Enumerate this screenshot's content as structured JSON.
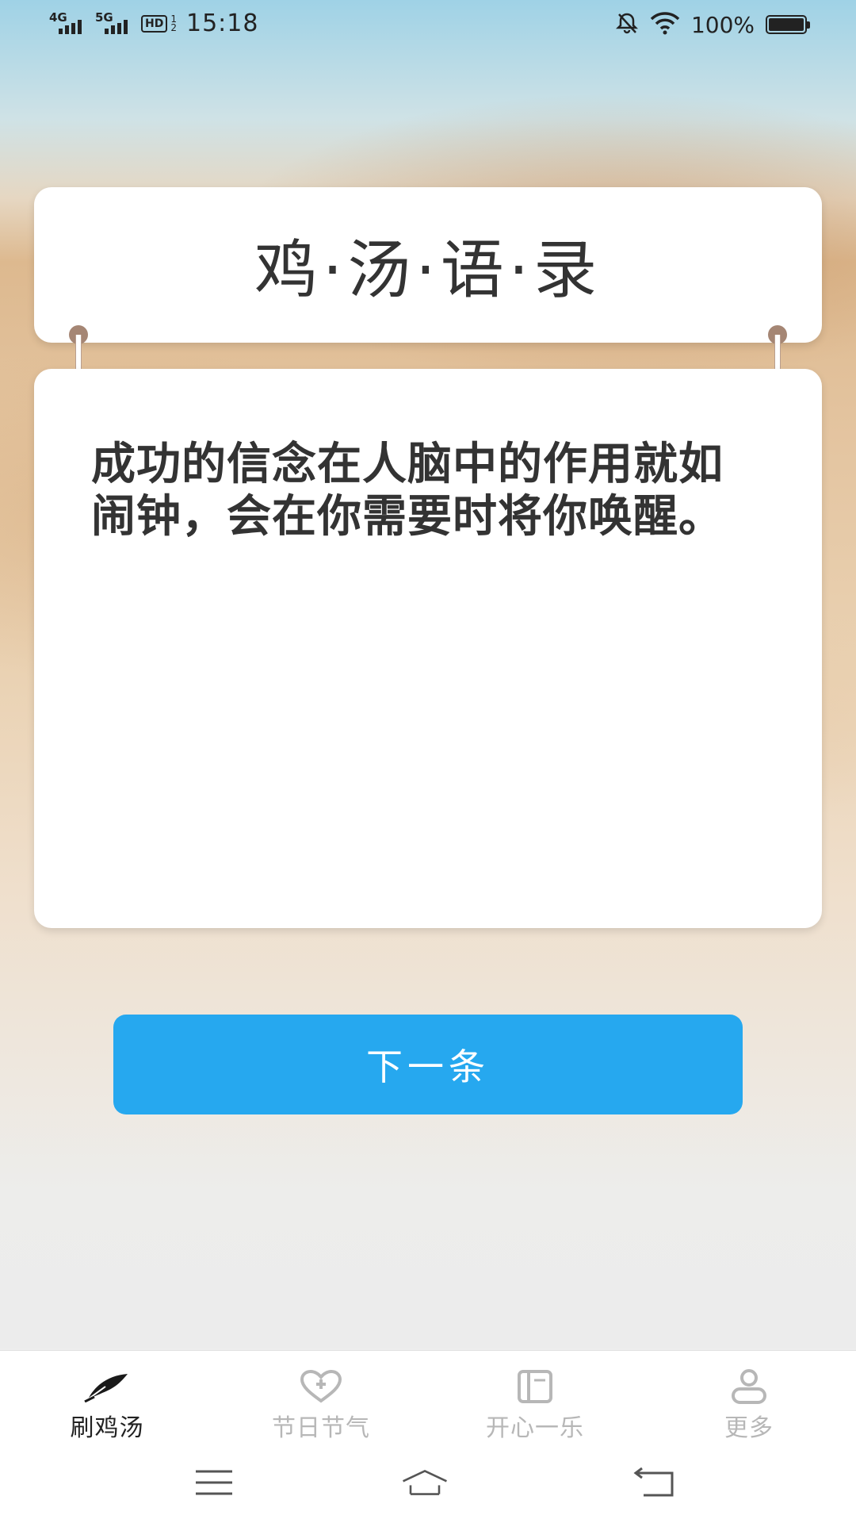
{
  "status_bar": {
    "network1": "4G",
    "network2": "5G",
    "hd": "HD",
    "hd_sub_top": "1",
    "hd_sub_bottom": "2",
    "time": "15:18",
    "battery_percent": "100%",
    "battery_level": 1.0
  },
  "title_card": {
    "title": "鸡·汤·语·录"
  },
  "quote_card": {
    "text": "成功的信念在人脑中的作用就如闹钟，会在你需要时将你唤醒。"
  },
  "actions": {
    "next_label": "下一条",
    "accent_color": "#26a8ef"
  },
  "tabbar": {
    "items": [
      {
        "label": "刷鸡汤",
        "icon": "feather-icon",
        "active": true
      },
      {
        "label": "节日节气",
        "icon": "heart-plus-icon",
        "active": false
      },
      {
        "label": "开心一乐",
        "icon": "book-icon",
        "active": false
      },
      {
        "label": "更多",
        "icon": "person-icon",
        "active": false
      }
    ]
  },
  "system_nav": {
    "menu_icon": "menu-icon",
    "home_icon": "home-icon",
    "back_icon": "back-icon"
  }
}
